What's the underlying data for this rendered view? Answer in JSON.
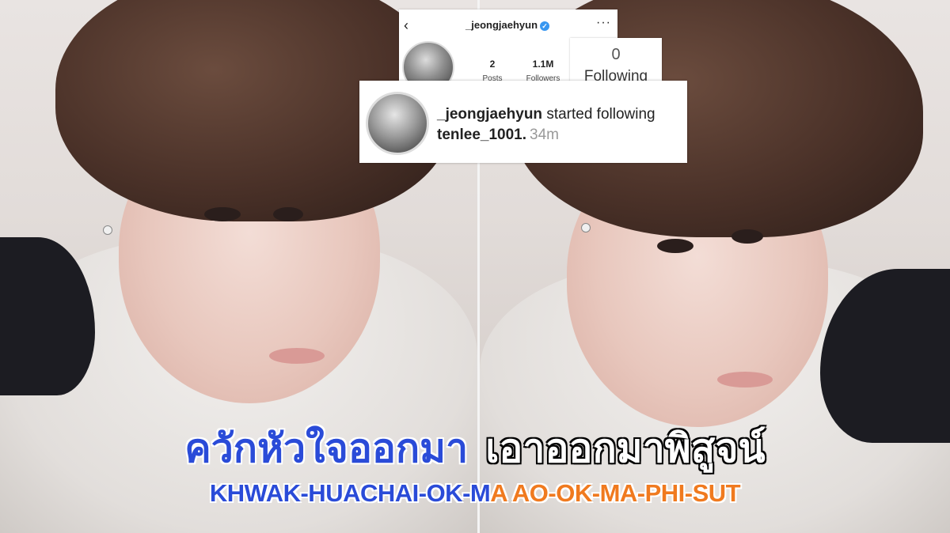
{
  "profile": {
    "username": "_jeongjaehyun",
    "verified_icon": "verified-badge-icon",
    "back_icon": "chevron-left-icon",
    "more_icon": "more-dots-icon",
    "back_glyph": "‹",
    "more_glyph": "···",
    "verified_glyph": "✓",
    "stats": [
      {
        "value": "2",
        "label": "Posts"
      },
      {
        "value": "1.1M",
        "label": "Followers"
      }
    ],
    "following": {
      "value": "0",
      "label": "Following"
    }
  },
  "notification": {
    "username": "_jeongjaehyun",
    "action": "started following",
    "target": "tenlee_1001.",
    "time": "34m"
  },
  "captions": {
    "thai_part1": "ควักหัวใจออกมา",
    "thai_part2": "เอาออกมาพิสูจน์",
    "roman_part1": "KHWAK-HUACHAI-OK-M",
    "roman_part2": "A AO-OK-MA-PHI-SUT"
  },
  "colors": {
    "caption_blue": "#2a4bd8",
    "caption_orange": "#f07a1f",
    "verified_blue": "#3897f0"
  }
}
